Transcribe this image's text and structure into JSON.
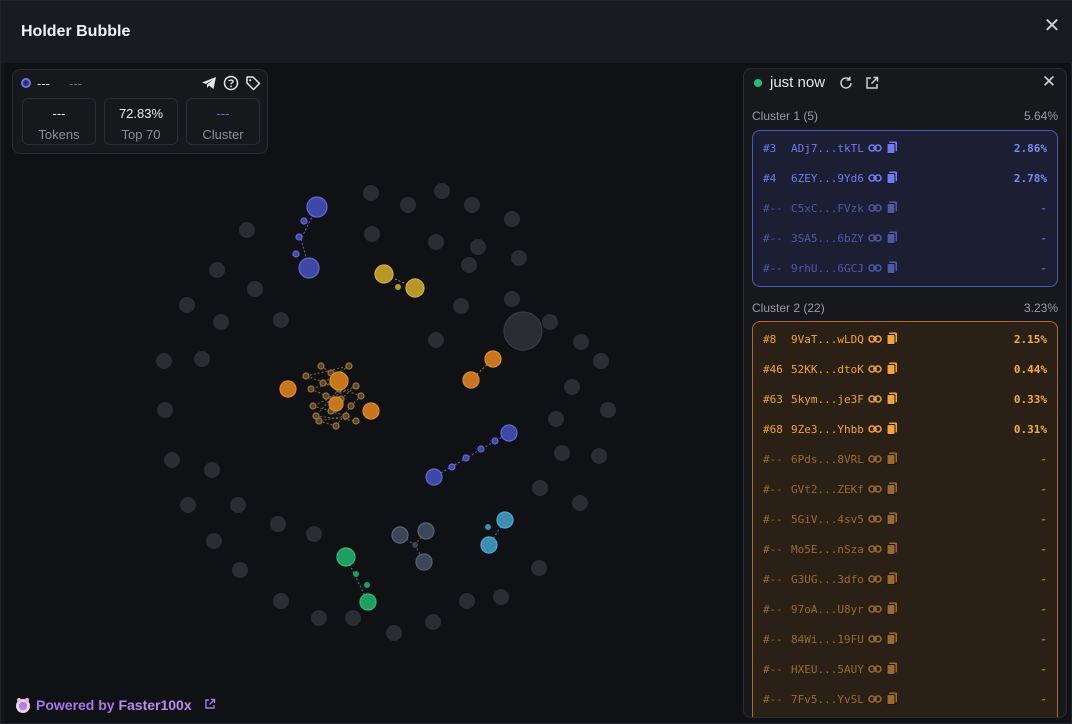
{
  "modal": {
    "title": "Holder Bubble",
    "close_icon": "close-icon"
  },
  "stats": {
    "token_name": "---",
    "token_sub": "---",
    "icons": [
      "telegram-icon",
      "help-icon",
      "tag-icon"
    ],
    "boxes": [
      {
        "value": "---",
        "label": "Tokens"
      },
      {
        "value": "72.83%",
        "label": "Top 70"
      },
      {
        "value": "---",
        "label": "Cluster"
      }
    ]
  },
  "footer": {
    "prefix": "Powered by ",
    "brand": "Faster100x"
  },
  "panel": {
    "status": "just now",
    "icons": [
      "refresh-icon",
      "external-link-icon",
      "close-icon"
    ],
    "clusters": [
      {
        "title": "Cluster 1 (5)",
        "percent": "5.64%",
        "color": "#6f7cf2",
        "rows": [
          {
            "rank": "#3",
            "address": "ADj7...tkTL",
            "percent": "2.86%"
          },
          {
            "rank": "#4",
            "address": "6ZEY...9Yd6",
            "percent": "2.78%"
          },
          {
            "rank": "#--",
            "address": "C5xC...FVzk",
            "percent": "-"
          },
          {
            "rank": "#--",
            "address": "3SA5...6bZY",
            "percent": "-"
          },
          {
            "rank": "#--",
            "address": "9rhU...6GCJ",
            "percent": "-"
          }
        ]
      },
      {
        "title": "Cluster 2 (22)",
        "percent": "3.23%",
        "color": "#f2a43a",
        "rows": [
          {
            "rank": "#8",
            "address": "9VaT...wLDQ",
            "percent": "2.15%"
          },
          {
            "rank": "#46",
            "address": "52KK...dtoK",
            "percent": "0.44%"
          },
          {
            "rank": "#63",
            "address": "5kym...je3F",
            "percent": "0.33%"
          },
          {
            "rank": "#68",
            "address": "9Ze3...Yhbb",
            "percent": "0.31%"
          },
          {
            "rank": "#--",
            "address": "6Pds...8VRL",
            "percent": "-"
          },
          {
            "rank": "#--",
            "address": "GVt2...ZEKf",
            "percent": "-"
          },
          {
            "rank": "#--",
            "address": "5GiV...4sv5",
            "percent": "-"
          },
          {
            "rank": "#--",
            "address": "Mo5E...nSza",
            "percent": "-"
          },
          {
            "rank": "#--",
            "address": "G3UG...3dfo",
            "percent": "-"
          },
          {
            "rank": "#--",
            "address": "97oA...U8yr",
            "percent": "-"
          },
          {
            "rank": "#--",
            "address": "84Wi...19FU",
            "percent": "-"
          },
          {
            "rank": "#--",
            "address": "HXEU...5AUY",
            "percent": "-"
          },
          {
            "rank": "#--",
            "address": "7Fv5...YvSL",
            "percent": "-"
          }
        ]
      }
    ]
  },
  "bubble_colors": {
    "neutral": "#2b2d33",
    "blue": "#3f48a6",
    "yellow": "#b8972a",
    "orange": "#c7761f",
    "teal": "#3a8fb0",
    "green": "#1f9e63",
    "slate": "#3b4658"
  }
}
